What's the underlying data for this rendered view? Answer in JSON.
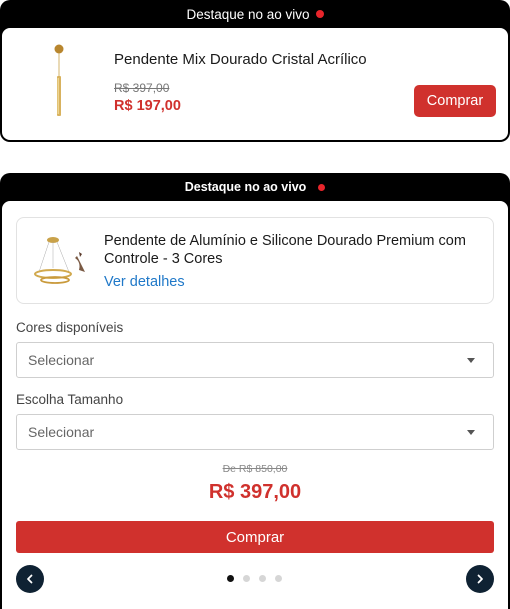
{
  "card1": {
    "header_text": "Destaque no ao vivo",
    "product_title": "Pendente Mix Dourado Cristal Acrílico",
    "old_price": "R$ 397,00",
    "new_price": "R$ 197,00",
    "buy_label": "Comprar"
  },
  "card2": {
    "header_text": "Destaque no ao vivo",
    "product_title": "Pendente de Alumínio e Silicone Dourado Premium com Controle - 3 Cores",
    "details_link": "Ver detalhes",
    "colors_label": "Cores disponíveis",
    "colors_select": "Selecionar",
    "size_label": "Escolha Tamanho",
    "size_select": "Selecionar",
    "old_price": "De R$ 850,00",
    "new_price": "R$ 397,00",
    "buy_label": "Comprar",
    "carousel": {
      "total": 4,
      "active": 1
    }
  },
  "colors": {
    "brand_red": "#d0312d",
    "live_dot": "#e8252b",
    "link_blue": "#1f78c8",
    "nav_dark": "#0f2233"
  },
  "icons": {
    "live": "live-indicator-dot",
    "select": "chevron-down-icon",
    "prev": "chevron-left-icon",
    "next": "chevron-right-icon"
  }
}
